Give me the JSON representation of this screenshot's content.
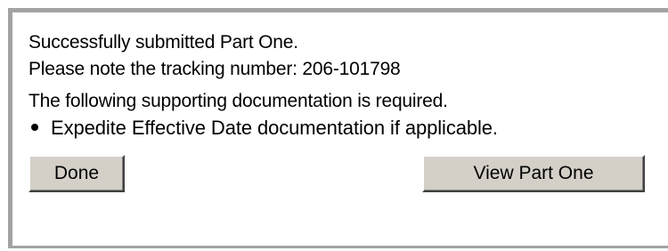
{
  "message": {
    "line1": "Successfully submitted Part One.",
    "line2": "Please note the tracking number: 206-101798",
    "line3": "The following supporting documentation is required."
  },
  "requirements": [
    "Expedite Effective Date documentation if applicable."
  ],
  "buttons": {
    "done_label": "Done",
    "view_part_one_label": "View Part One"
  }
}
